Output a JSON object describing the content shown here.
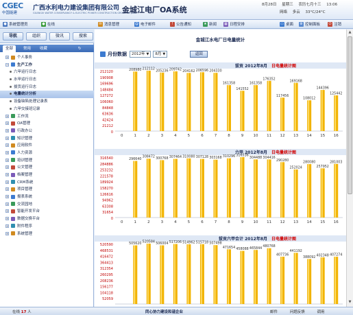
{
  "header": {
    "logo_text": "CGEC",
    "logo_subtext": "中国能建",
    "company_cn": "广西水利电力建设集团有限公司",
    "company_en": "GUANGXI WATER CONSERVANCY & ELECTRIC POWER CONSTRUCTION GROUP CO.,LTD",
    "system_title": "金城江电厂OA系统",
    "date": "8月28日",
    "weekday": "星期三",
    "lunar": "农历七月十三",
    "clock": "13:06",
    "links": [
      "网络",
      "多云",
      "33°C/24°C"
    ]
  },
  "toolbar": {
    "left_items": [
      {
        "label": "系统管理员",
        "icon": "user-icon"
      },
      {
        "label": "在线",
        "icon": "status-icon"
      }
    ],
    "center_items": [
      {
        "label": "消息管理",
        "icon": "message-icon"
      },
      {
        "label": "电子邮件",
        "icon": "mail-icon"
      },
      {
        "label": "公告通知",
        "icon": "notice-icon"
      },
      {
        "label": "新闻",
        "icon": "news-icon"
      },
      {
        "label": "日程安排",
        "icon": "calendar-icon"
      }
    ],
    "right_items": [
      {
        "label": "桌面",
        "icon": "desktop-icon"
      },
      {
        "label": "控制面板",
        "icon": "control-panel-icon"
      },
      {
        "label": "注销",
        "icon": "logout-icon"
      }
    ]
  },
  "sidebar": {
    "tabs": [
      "导航",
      "组织",
      "微讯",
      "搜索"
    ],
    "active_tab": "导航",
    "sub_tabs": [
      "全部",
      "常用",
      "收藏"
    ],
    "items": [
      {
        "label": "个人事务",
        "type": "group",
        "expanded": false
      },
      {
        "label": "生产工作",
        "type": "group",
        "expanded": true
      },
      {
        "label": "六甲运行日志",
        "type": "child"
      },
      {
        "label": "水甲运行日志",
        "type": "child"
      },
      {
        "label": "拔贡运行日志",
        "type": "child"
      },
      {
        "label": "电量统计分析",
        "type": "child",
        "selected": true
      },
      {
        "label": "设备缺陷处理记录表",
        "type": "child"
      },
      {
        "label": "六甲交接班记录",
        "type": "child"
      },
      {
        "label": "工作流",
        "type": "group"
      },
      {
        "label": "OA管理",
        "type": "group"
      },
      {
        "label": "行政办公",
        "type": "group"
      },
      {
        "label": "知识管理",
        "type": "group"
      },
      {
        "label": "应用软件",
        "type": "group"
      },
      {
        "label": "人力资源",
        "type": "group"
      },
      {
        "label": "培训管理",
        "type": "group"
      },
      {
        "label": "公文管理",
        "type": "group"
      },
      {
        "label": "档案管理",
        "type": "group"
      },
      {
        "label": "CRM系统",
        "type": "group"
      },
      {
        "label": "项目管理",
        "type": "group"
      },
      {
        "label": "报表系统",
        "type": "group"
      },
      {
        "label": "交流园地",
        "type": "group"
      },
      {
        "label": "智能开发平台",
        "type": "group"
      },
      {
        "label": "数据交换平台",
        "type": "group"
      },
      {
        "label": "附件程序",
        "type": "group"
      },
      {
        "label": "系统管理",
        "type": "group"
      }
    ]
  },
  "main": {
    "title": "金城江水电厂日电量统计",
    "month_label": "月份数据",
    "year_value": "2012年",
    "month_value": "8月",
    "back_button": "返回"
  },
  "status": {
    "online_label": "在线",
    "online_count": "17",
    "online_unit": "人",
    "slogan": "同心协力建设和谐企业",
    "links": [
      "邮件",
      "问题反馈",
      "调用"
    ]
  },
  "chart_data": [
    {
      "type": "bar",
      "header": "拔贡 2012年8月",
      "header_highlight": "日电量统计图",
      "x": [
        "0",
        "1",
        "2",
        "3",
        "4",
        "5",
        "6",
        "7",
        "8",
        "9",
        "10",
        "11",
        "12",
        "13",
        "14",
        "15",
        "16"
      ],
      "values": [
        null,
        208980,
        212112,
        205236,
        209742,
        204162,
        206596,
        204330,
        161358,
        141552,
        161358,
        176352,
        117456,
        169168,
        108012,
        144396,
        125442
      ],
      "y_ticks": [
        "212120",
        "190908",
        "169696",
        "148484",
        "127272",
        "106060",
        "84848",
        "63636",
        "42424",
        "21212",
        "0"
      ],
      "ylim": [
        0,
        212120
      ],
      "bar_color": "#f2b300"
    },
    {
      "type": "bar",
      "header": "六甲 2012年8月",
      "header_highlight": "日电量统计图",
      "x": [
        "0",
        "1",
        "2",
        "3",
        "4",
        "5",
        "6",
        "7",
        "8",
        "9",
        "10",
        "11",
        "12",
        "13",
        "14",
        "15",
        "16"
      ],
      "values": [
        null,
        296640,
        308472,
        300768,
        307464,
        310080,
        307128,
        303168,
        310296,
        316536,
        304488,
        304416,
        290280,
        252024,
        280080,
        257952,
        281003
      ],
      "y_ticks": [
        "316540",
        "284886",
        "253232",
        "221578",
        "189924",
        "158270",
        "126616",
        "94962",
        "63308",
        "31654",
        "0"
      ],
      "ylim": [
        0,
        316540
      ],
      "bar_color": "#f2b300"
    },
    {
      "type": "bar",
      "header": "拔贡六甲合计 2012年8月",
      "header_highlight": "日电量统计图",
      "x": [
        "0",
        "1",
        "2",
        "3",
        "4",
        "5",
        "6",
        "7",
        "8",
        "9",
        "10",
        "11",
        "12",
        "13",
        "14",
        "15",
        "16"
      ],
      "values": [
        null,
        505620,
        520584,
        506004,
        517206,
        514962,
        515718,
        507498,
        471654,
        458088,
        465844,
        480768,
        407736,
        441192,
        388092,
        402348,
        407274
      ],
      "y_ticks": [
        "520590",
        "468531",
        "416472",
        "364413",
        "312354",
        "260295",
        "208236",
        "156177",
        "104118",
        "52059"
      ],
      "ylim": [
        0,
        520590
      ],
      "bar_color": "#f2b300"
    }
  ]
}
